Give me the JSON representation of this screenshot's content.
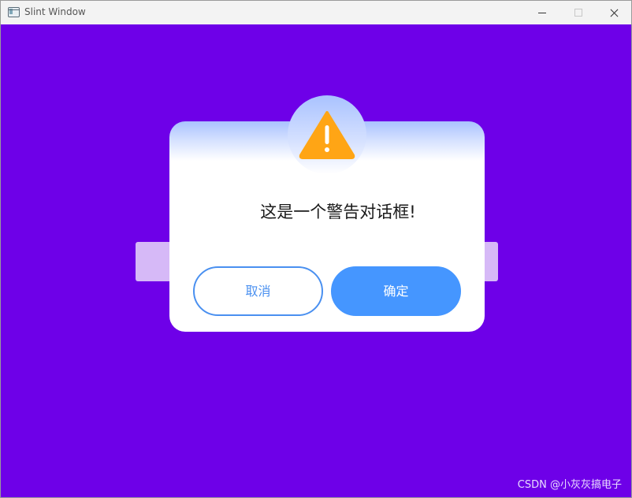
{
  "window": {
    "title": "Slint Window",
    "icon": "app-window-icon",
    "controls": [
      "minimize-icon",
      "maximize-icon",
      "close-icon"
    ]
  },
  "colors": {
    "background": "#6e00e8",
    "behind_bar": "#d6b9f7",
    "dialog_header_gradient": "#a9c2ff",
    "warning": "#ffa515",
    "accent": "#4596ff"
  },
  "dialog": {
    "icon": "warning-icon",
    "message": "这是一个警告对话框!",
    "cancel_label": "取消",
    "ok_label": "确定"
  },
  "watermark": "CSDN @小灰灰搞电子"
}
